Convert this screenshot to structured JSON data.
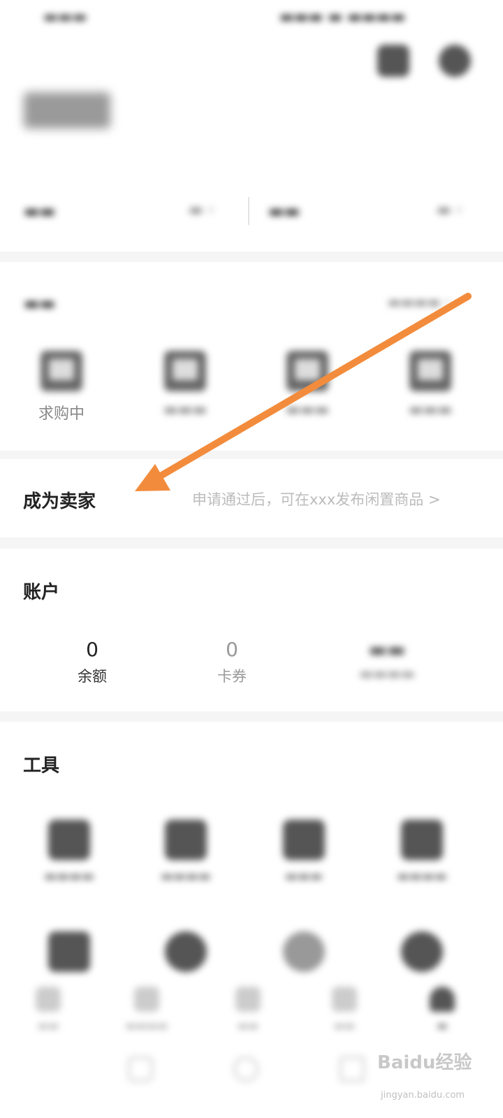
{
  "seller": {
    "title": "成为卖家",
    "hint": "申请通过后，可在xxx发布闲置商品 >"
  },
  "buy": {
    "first_label": "求购中"
  },
  "account": {
    "title": "账户",
    "items": [
      {
        "value": "0",
        "label": "余额"
      },
      {
        "value": "0",
        "label": "卡券"
      }
    ]
  },
  "tools": {
    "title": "工具"
  },
  "watermark": {
    "brand": "Baidu经验",
    "url": "jingyan.baidu.com"
  },
  "colors": {
    "arrow": "#f28c3c",
    "background": "#f5f5f5"
  }
}
